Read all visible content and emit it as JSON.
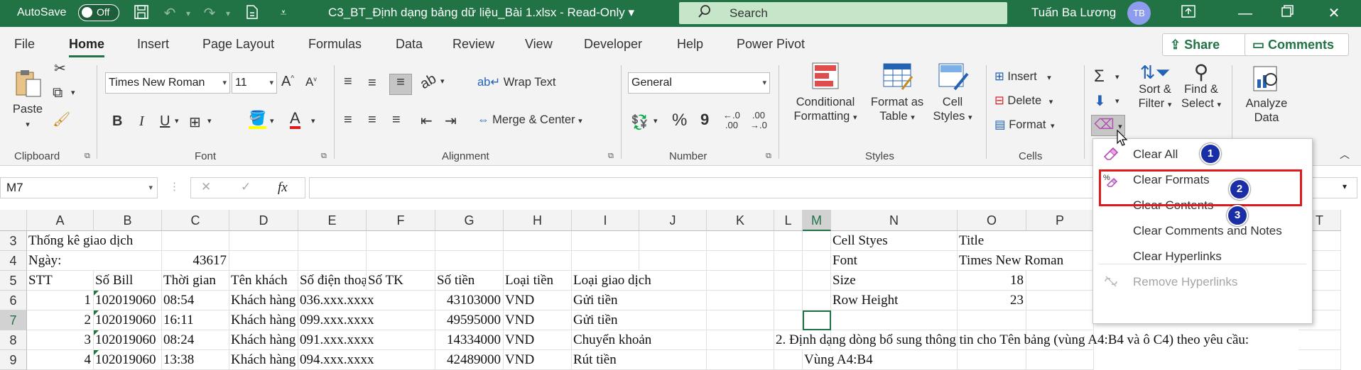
{
  "title_bar": {
    "autosave_label": "AutoSave",
    "autosave_state": "Off",
    "filename": "C3_BT_Định dạng bảng dữ liệu_Bài 1.xlsx  -  Read-Only",
    "filename_caret": "▾",
    "search_placeholder": "Search",
    "user_name": "Tuấn Ba Lương",
    "user_initials": "TB"
  },
  "tabs": [
    "File",
    "Home",
    "Insert",
    "Page Layout",
    "Formulas",
    "Data",
    "Review",
    "View",
    "Developer",
    "Help",
    "Power Pivot"
  ],
  "share_label": "Share",
  "comments_label": "Comments",
  "ribbon": {
    "clipboard": {
      "paste": "Paste",
      "group": "Clipboard"
    },
    "font": {
      "name": "Times New Roman",
      "size": "11",
      "group": "Font",
      "bold": "B",
      "italic": "I",
      "underline": "U"
    },
    "alignment": {
      "wrap_text": "Wrap Text",
      "merge_center": "Merge & Center",
      "group": "Alignment"
    },
    "number": {
      "format": "General",
      "percent": "%",
      "comma": "9",
      "group": "Number"
    },
    "styles": {
      "conditional_formatting": [
        "Conditional",
        "Formatting"
      ],
      "format_as_table": [
        "Format as",
        "Table"
      ],
      "cell_styles": [
        "Cell",
        "Styles"
      ],
      "group": "Styles"
    },
    "cells": {
      "insert": "Insert",
      "delete": "Delete",
      "format": "Format",
      "group": "Cells"
    },
    "editing": {
      "sort_filter": [
        "Sort &",
        "Filter"
      ],
      "find_select": [
        "Find &",
        "Select"
      ]
    },
    "analysis": {
      "analyze_data": [
        "Analyze",
        "Data"
      ]
    }
  },
  "formula_bar": {
    "name_box": "M7",
    "cancel": "✕",
    "enter": "✓",
    "fx": "fx",
    "content": ""
  },
  "columns": [
    "A",
    "B",
    "C",
    "D",
    "E",
    "F",
    "G",
    "H",
    "I",
    "J",
    "K",
    "L",
    "M",
    "N",
    "O",
    "P",
    "T"
  ],
  "selected_column": "M",
  "rows": [
    {
      "num": "3",
      "cells": {
        "A": "Thống kê giao dịch",
        "N": "Cell Styes",
        "O": "Title"
      }
    },
    {
      "num": "4",
      "cells": {
        "A": "Ngày:",
        "C": "43617",
        "N": "Font",
        "O": "Times New Roman"
      }
    },
    {
      "num": "5",
      "cells": {
        "A": "STT",
        "B": "Số Bill",
        "C": "Thời gian",
        "D": "Tên khách",
        "E": "Số điện thoại",
        "F": "Số TK",
        "G": "Số tiền",
        "H": "Loại tiền",
        "I": "Loại giao dịch",
        "N": "Size",
        "O": "18"
      }
    },
    {
      "num": "6",
      "cells": {
        "A": "1",
        "B": "102019060",
        "C": "08:54",
        "D": "Khách hàng",
        "E": "036.xxx.xxxx",
        "G": "43103000",
        "H": "VND",
        "I": "Gửi tiền",
        "N": "Row Height",
        "O": "23"
      }
    },
    {
      "num": "7",
      "cells": {
        "A": "2",
        "B": "102019060",
        "C": "16:11",
        "D": "Khách hàng",
        "E": "099.xxx.xxxx",
        "G": "49595000",
        "H": "VND",
        "I": "Gửi tiền"
      }
    },
    {
      "num": "8",
      "cells": {
        "A": "3",
        "B": "102019060",
        "C": "08:24",
        "D": "Khách hàng",
        "E": "091.xxx.xxxx",
        "G": "14334000",
        "H": "VND",
        "I": "Chuyển khoản",
        "L": "2. Định dạng dòng bổ sung thông tin cho Tên bảng (vùng A4:B4 và ô C4) theo yêu cầu:"
      }
    },
    {
      "num": "9",
      "cells": {
        "A": "4",
        "B": "102019060",
        "C": "13:38",
        "D": "Khách hàng",
        "E": "094.xxx.xxxx",
        "G": "42489000",
        "H": "VND",
        "I": "Rút tiền",
        "M": "Vùng A4:B4"
      }
    }
  ],
  "clear_menu": {
    "items": [
      {
        "label": "Clear All",
        "icon": "eraser-icon",
        "disabled": false
      },
      {
        "label": "Clear Formats",
        "icon": "clear-formats-icon",
        "disabled": false
      },
      {
        "label": "Clear Contents",
        "icon": "",
        "disabled": false
      },
      {
        "label": "Clear Comments and Notes",
        "icon": "",
        "disabled": false
      },
      {
        "label": "Clear Hyperlinks",
        "icon": "",
        "disabled": false
      },
      {
        "label": "Remove Hyperlinks",
        "icon": "unlink-icon",
        "disabled": true
      }
    ],
    "badges": [
      "1",
      "2",
      "3"
    ]
  },
  "colors": {
    "excel_green": "#217346",
    "highlight_red": "#e0191c",
    "badge_blue": "#1a2ea6"
  }
}
